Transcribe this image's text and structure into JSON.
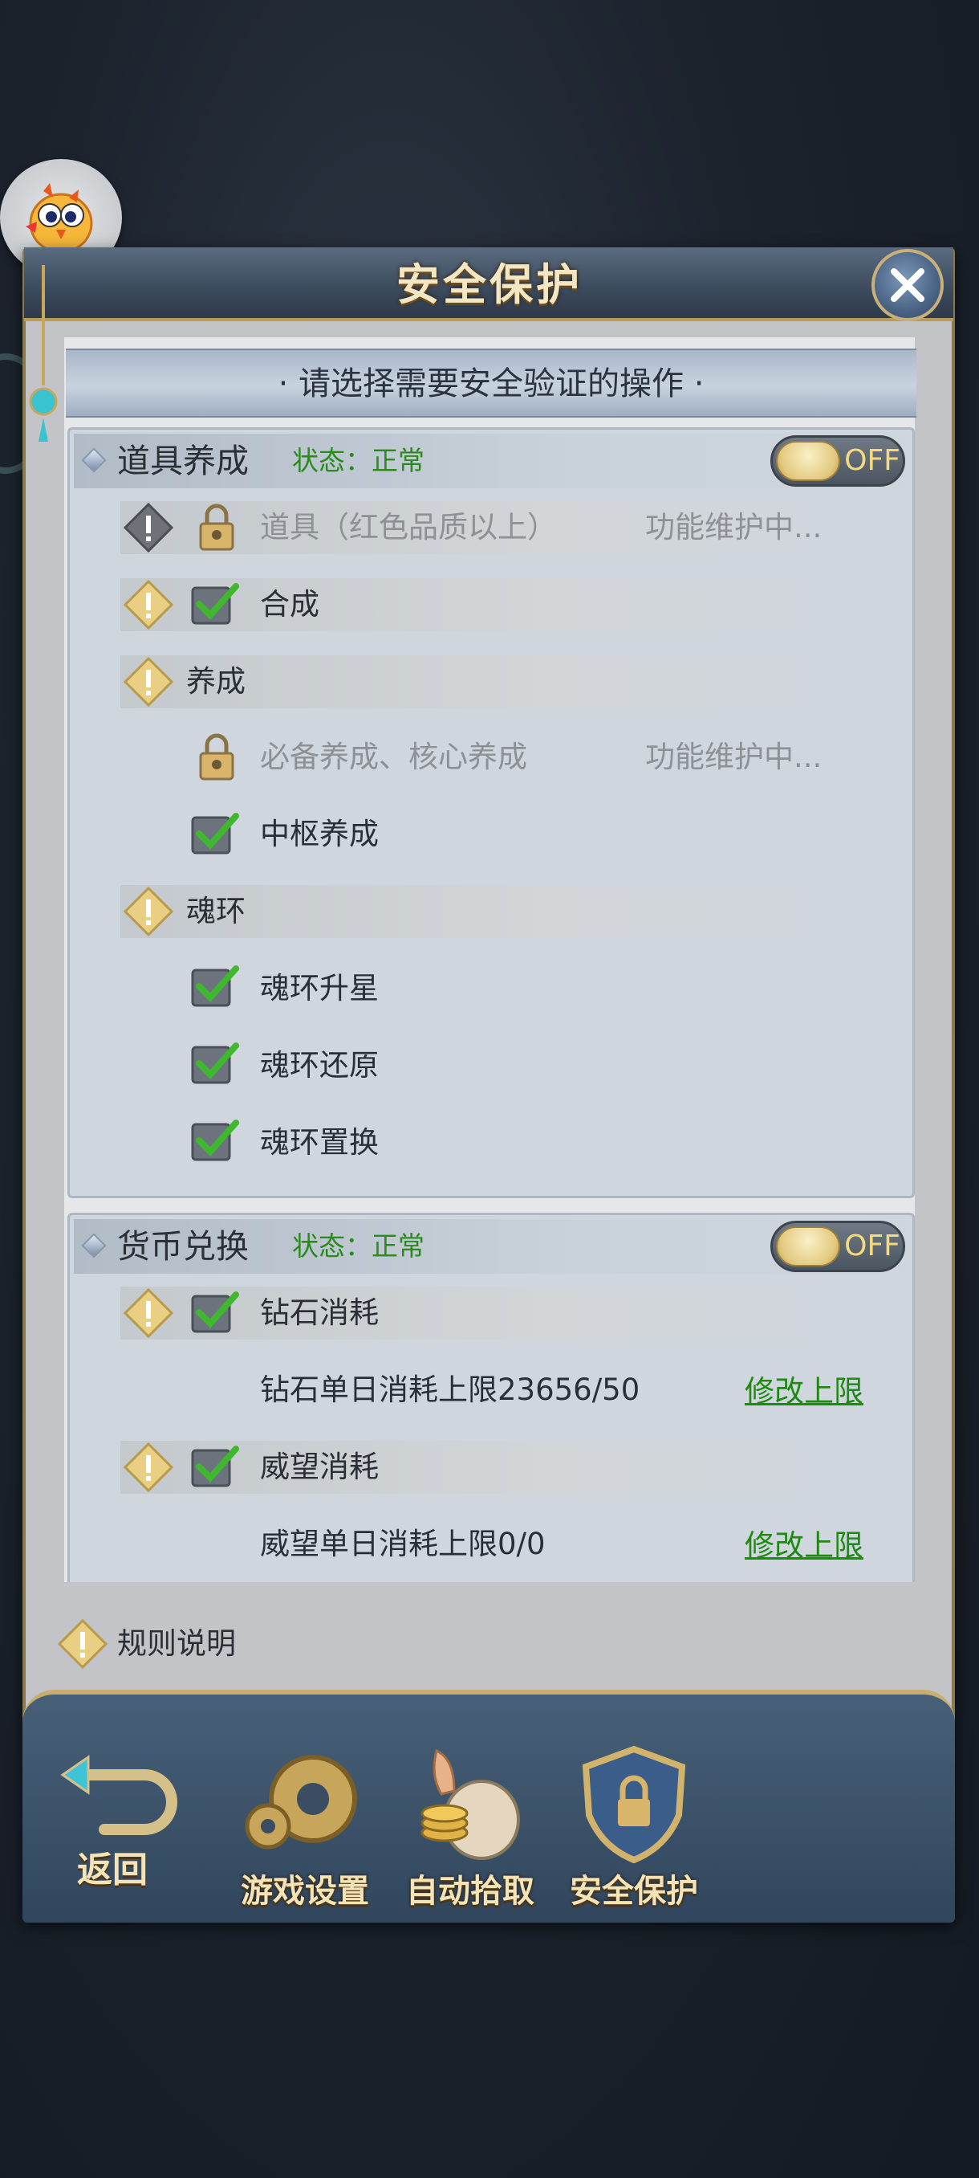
{
  "dialog": {
    "title": "安全保护",
    "close_icon": "close-icon",
    "banner": "· 请选择需要安全验证的操作 ·"
  },
  "sections": [
    {
      "title": "道具养成",
      "status": "状态：正常",
      "toggle": "OFF",
      "rows": [
        {
          "label": "道具（红色品质以上）",
          "note": "功能维护中..."
        },
        {
          "label": "合成"
        },
        {
          "label": "养成"
        },
        {
          "label": "必备养成、核心养成",
          "note": "功能维护中..."
        },
        {
          "label": "中枢养成"
        },
        {
          "label": "魂环"
        },
        {
          "label": "魂环升星"
        },
        {
          "label": "魂环还原"
        },
        {
          "label": "魂环置换"
        }
      ]
    },
    {
      "title": "货币兑换",
      "status": "状态：正常",
      "toggle": "OFF",
      "rows": [
        {
          "label": "钻石消耗"
        },
        {
          "label": "钻石单日消耗上限23656/50",
          "link": "修改上限"
        },
        {
          "label": "威望消耗"
        },
        {
          "label": "威望单日消耗上限0/0",
          "link": "修改上限"
        }
      ]
    }
  ],
  "rules": "规则说明",
  "nav": {
    "back": "返回",
    "items": [
      "游戏设置",
      "自动拾取",
      "安全保护"
    ]
  },
  "colors": {
    "status_green": "#2a8a1c",
    "title_gold": "#f3e6c3",
    "toggle_text": "#f4d97d"
  }
}
